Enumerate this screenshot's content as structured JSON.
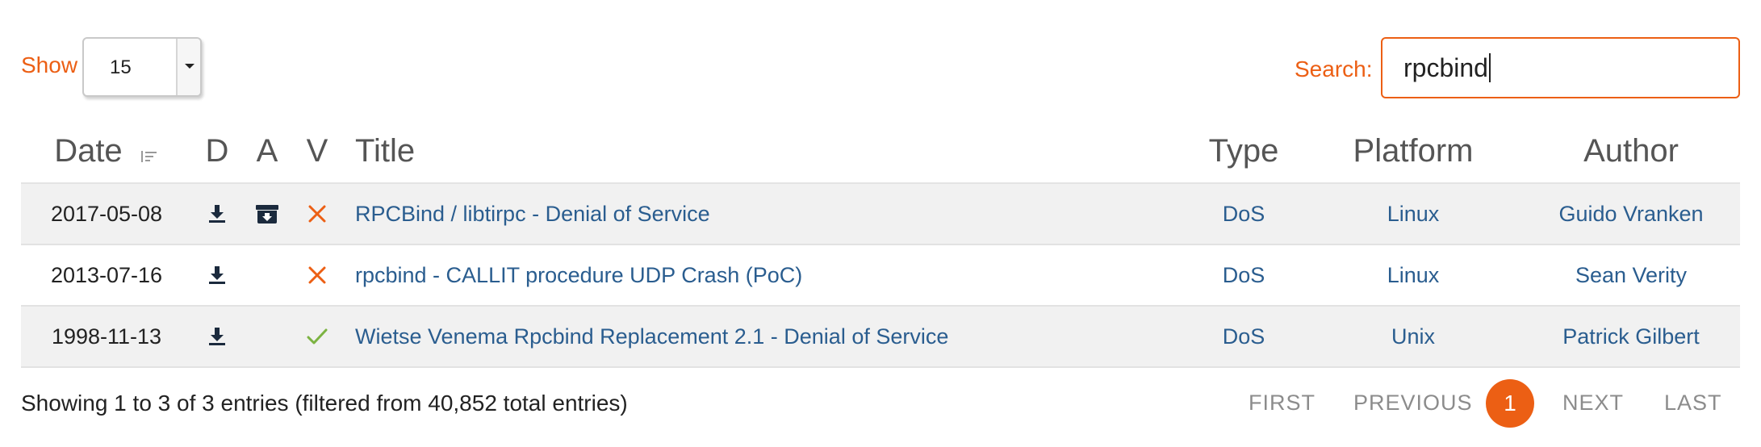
{
  "controls": {
    "show_label": "Show",
    "show_value": "15",
    "search_label": "Search:",
    "search_value": "rpcbind"
  },
  "table": {
    "headers": {
      "date": "Date",
      "d": "D",
      "a": "A",
      "v": "V",
      "title": "Title",
      "type": "Type",
      "platform": "Platform",
      "author": "Author"
    },
    "rows": [
      {
        "date": "2017-05-08",
        "download": true,
        "app": true,
        "verified": false,
        "title": "RPCBind / libtirpc - Denial of Service",
        "type": "DoS",
        "platform": "Linux",
        "author": "Guido Vranken"
      },
      {
        "date": "2013-07-16",
        "download": true,
        "app": false,
        "verified": false,
        "title": "rpcbind - CALLIT procedure UDP Crash (PoC)",
        "type": "DoS",
        "platform": "Linux",
        "author": "Sean Verity"
      },
      {
        "date": "1998-11-13",
        "download": true,
        "app": false,
        "verified": true,
        "title": "Wietse Venema Rpcbind Replacement 2.1 - Denial of Service",
        "type": "DoS",
        "platform": "Unix",
        "author": "Patrick Gilbert"
      }
    ]
  },
  "footer": {
    "info": "Showing 1 to 3 of 3 entries (filtered from 40,852 total entries)",
    "first": "FIRST",
    "previous": "PREVIOUS",
    "current_page": "1",
    "next": "NEXT",
    "last": "LAST"
  },
  "colors": {
    "accent": "#ec5f14",
    "link": "#2a5d8f",
    "verified": "#7cb342",
    "unverified": "#ec5f14",
    "icon_dark": "#1b2a3d"
  },
  "icons": {
    "sort": "sort-icon",
    "download": "download-icon",
    "archive": "archive-icon",
    "unverified": "x-icon",
    "verified": "check-icon",
    "dropdown": "caret-down-icon"
  }
}
